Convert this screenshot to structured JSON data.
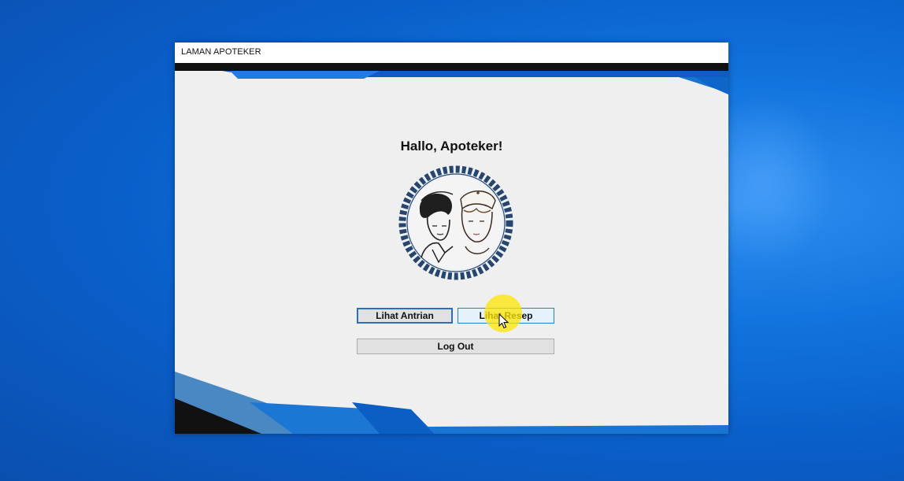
{
  "window": {
    "title": "LAMAN APOTEKER"
  },
  "main": {
    "greeting": "Hallo, Apoteker!"
  },
  "buttons": {
    "lihat_antrian": "Lihat Antrian",
    "lihat_resep": "Lihat Resep",
    "log_out": "Log Out"
  },
  "colors": {
    "desktop_blue": "#0a5fca",
    "accent_blue": "#1a74d1",
    "window_bg": "#efefef",
    "logo_navy": "#27466d",
    "click_highlight": "#ffe600"
  },
  "icons": {
    "logo": "pharmacist-nurses-emblem",
    "cursor": "mouse-pointer-icon"
  }
}
